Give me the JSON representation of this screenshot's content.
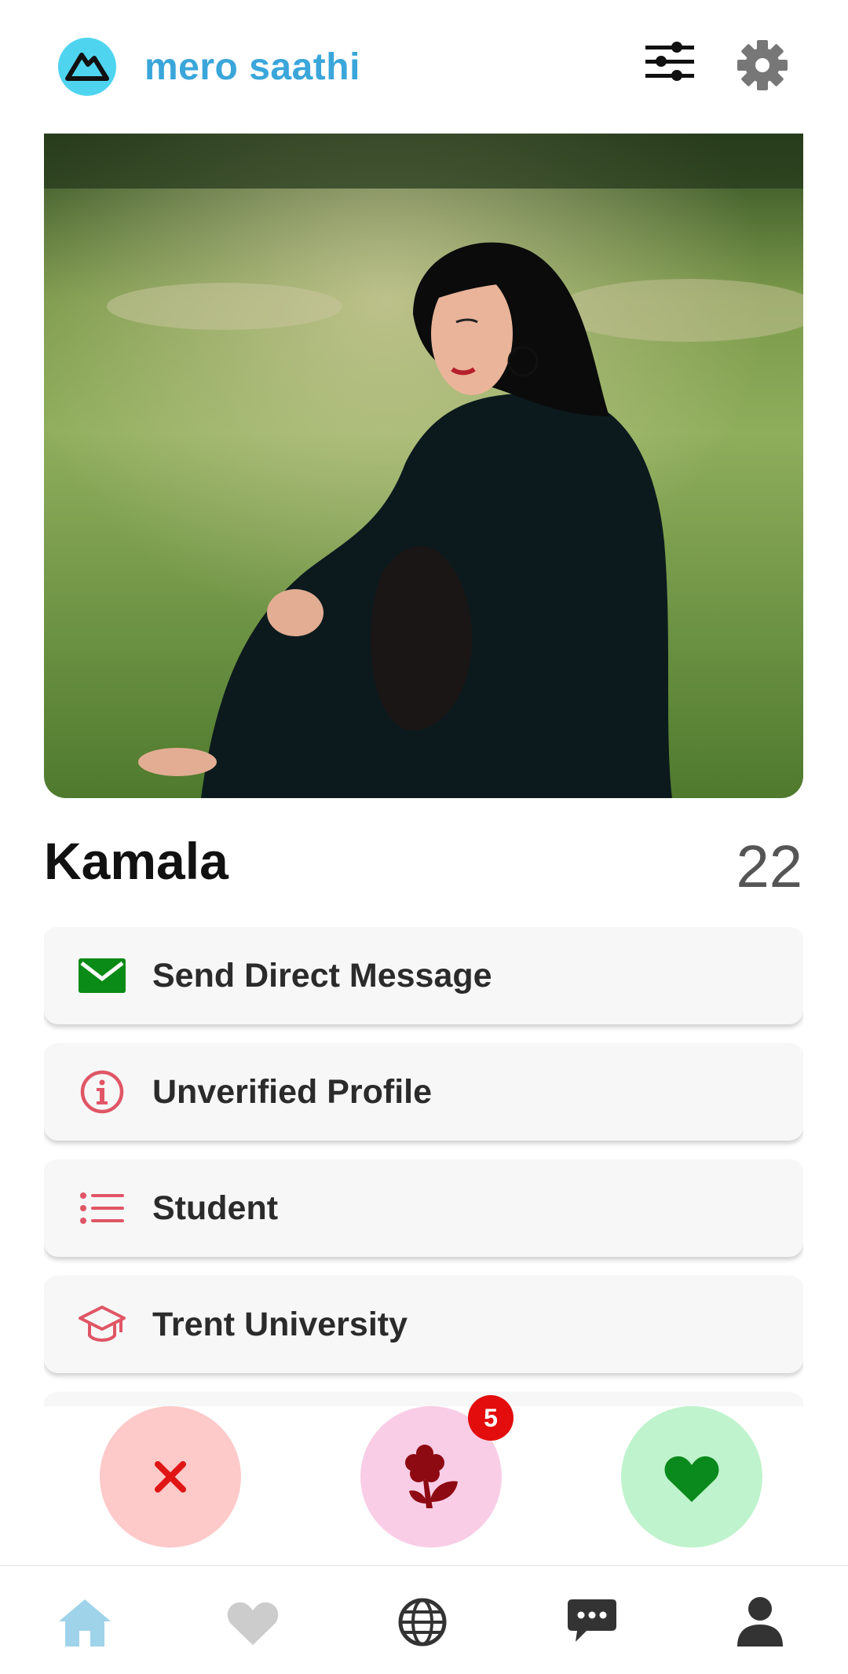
{
  "app": {
    "title": "mero saathi"
  },
  "profile": {
    "name": "Kamala",
    "age": "22"
  },
  "cards": [
    {
      "label": "Send Direct Message",
      "icon": "mail-icon"
    },
    {
      "label": "Unverified Profile",
      "icon": "info-icon"
    },
    {
      "label": "Student",
      "icon": "list-icon"
    },
    {
      "label": "Trent University",
      "icon": "graduation-cap-icon"
    }
  ],
  "actions": {
    "rose_badge": "5"
  },
  "nav": [
    "home-icon",
    "heart-icon",
    "globe-icon",
    "chat-icon",
    "person-icon"
  ],
  "colors": {
    "brand": "#3aa6da",
    "accent_red": "#e05666",
    "mail_green": "#0a8a16",
    "reject_bg": "#fdc9c9",
    "rose_bg": "#f9cde6",
    "like_bg": "#bff3cd",
    "nav_active": "#9fd3ea",
    "nav_inactive": "#cccccc"
  }
}
